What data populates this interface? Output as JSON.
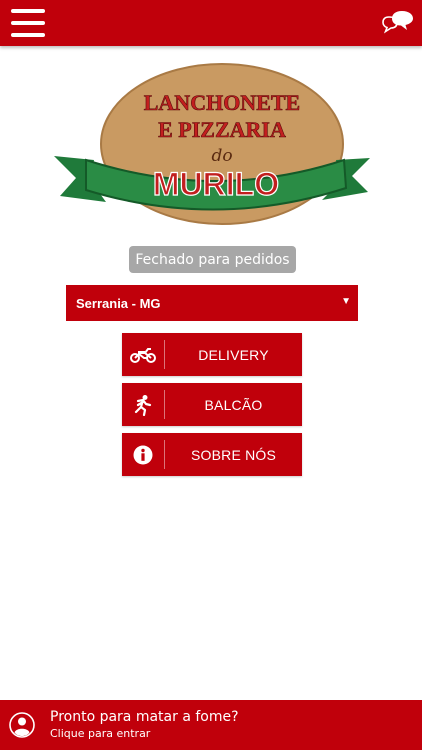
{
  "header": {
    "menu_icon": "hamburger-menu-icon",
    "chat_icon": "chat-bubbles-icon"
  },
  "logo": {
    "line1": "LANCHONETE",
    "line2": "E PIZZARIA",
    "line3": "do",
    "line4": "MURILO",
    "colors": {
      "board": "#c99a62",
      "ribbon": "#1f7a3a",
      "text": "#c21f1f"
    }
  },
  "status": {
    "text": "Fechado para pedidos"
  },
  "city_select": {
    "selected": "Serrania - MG"
  },
  "actions": [
    {
      "icon": "motorcycle-icon",
      "label": "DELIVERY"
    },
    {
      "icon": "running-person-icon",
      "label": "BALCÃO"
    },
    {
      "icon": "info-icon",
      "label": "SOBRE NÓS"
    }
  ],
  "footer": {
    "icon": "user-icon",
    "title": "Pronto para matar a fome?",
    "subtitle": "Clique para entrar"
  },
  "colors": {
    "primary": "#c0000b",
    "badge": "#a7a7a7"
  }
}
